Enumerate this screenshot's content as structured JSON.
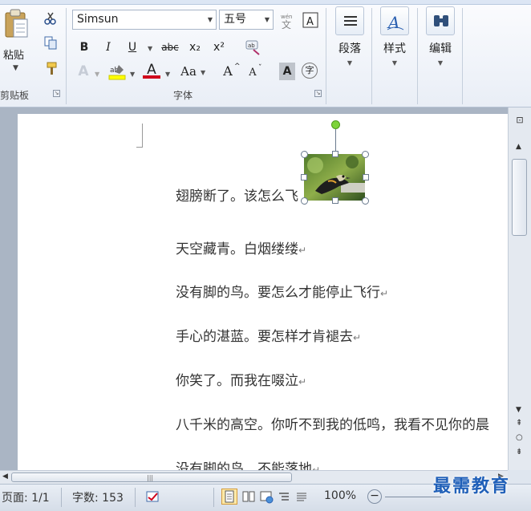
{
  "ribbon": {
    "clipboard": {
      "paste_label": "粘贴",
      "group_label": "剪贴板"
    },
    "font": {
      "font_name": "Simsun",
      "font_size": "五号",
      "group_label": "字体",
      "bold": "B",
      "italic": "I",
      "underline": "U",
      "strikethrough": "abc",
      "subscript": "x₂",
      "superscript": "x²",
      "clear_format": "A",
      "font_color": "A",
      "change_case": "Aa",
      "grow_font": "A",
      "shrink_font": "A",
      "char_shading": "A",
      "enclose_char": "字"
    },
    "paragraph_label": "段落",
    "styles_label": "样式",
    "editing_label": "编辑"
  },
  "document": {
    "paragraphs": [
      "翅膀断了。该怎么飞",
      "天空藏青。白烟缕缕",
      "没有脚的鸟。要怎么才能停止飞行",
      "手心的湛蓝。要怎样才肯褪去",
      "你笑了。而我在啜泣",
      "八千米的高空。你听不到我的低鸣，我看不见你的晨",
      "没有脚的鸟。不能落地"
    ],
    "para_mark": "↵"
  },
  "status": {
    "page": "页面: 1/1",
    "words": "字数: 153",
    "zoom": "100%"
  },
  "watermark": "最需教育",
  "colors": {
    "accent": "#1f5fb8",
    "highlight": "#ffff00",
    "font_red": "#d0021b",
    "rotate_handle": "#7dd33a"
  }
}
